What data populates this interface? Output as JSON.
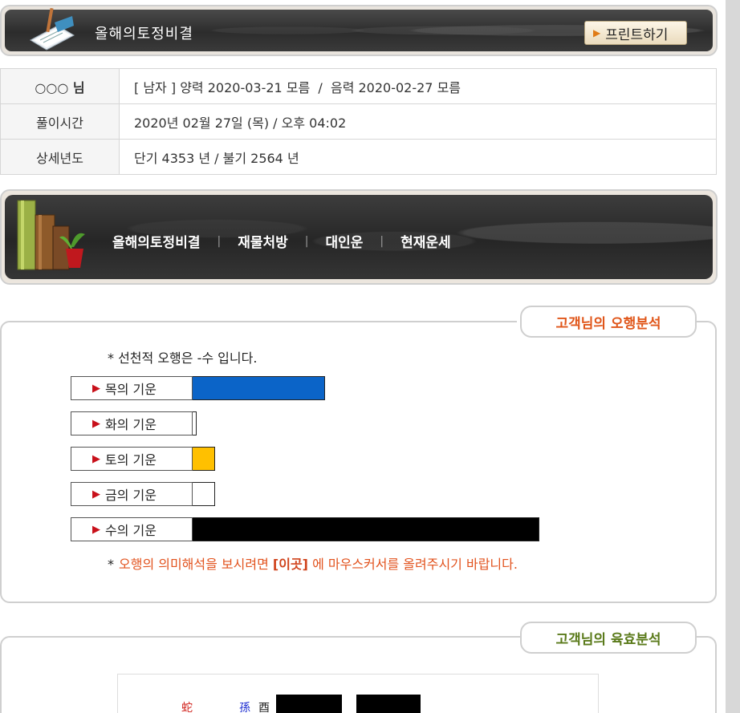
{
  "header": {
    "title": "올해의토정비결",
    "print_label": "프린트하기",
    "icon_name": "pen-book-icon"
  },
  "info": {
    "name": "○○○ 님",
    "gender": "[ 남자 ]",
    "birth": "양력 2020-03-21 모름  /  음력 2020-02-27 모름",
    "time_label": "풀이시간",
    "time_value": "2020년 02월 27일 (목) / 오후 04:02",
    "year_label": "상세년도",
    "year_value": "단기 4353 년 / 불기 2564 년"
  },
  "menu": {
    "items": [
      "올해의토정비결",
      "재물처방",
      "대인운",
      "현재운세"
    ],
    "separator": "|"
  },
  "ohang": {
    "tab_title": "고객님의 오행분석",
    "note": "* 선천적 오행은 -수 입니다.",
    "bars": [
      {
        "label": "목의 기운",
        "value": 35,
        "color": "#0b64c8"
      },
      {
        "label": "화의 기운",
        "value": 1,
        "color": "#ffffff"
      },
      {
        "label": "토의 기운",
        "value": 6,
        "color": "#ffc000"
      },
      {
        "label": "금의 기운",
        "value": 6,
        "color": "#ffffff"
      },
      {
        "label": "수의 기운",
        "value": 92,
        "color": "#000000"
      }
    ],
    "hint_star": "*",
    "hint_pre": "오행의 의미해석을 보시려면 ",
    "hint_link": "[이곳]",
    "hint_post": " 에 마우스커서를 올려주시기 바랍니다."
  },
  "yukhyo": {
    "tab_title": "고객님의 육효분석",
    "chars": [
      "蛇",
      "孫",
      "酉"
    ]
  },
  "colors": {
    "accent_orange": "#e2521d",
    "tab_green": "#5a7a1a",
    "tab_orange": "#e0561a",
    "mok_blue": "#0b64c8",
    "to_yellow": "#ffc000",
    "su_black": "#000000"
  }
}
